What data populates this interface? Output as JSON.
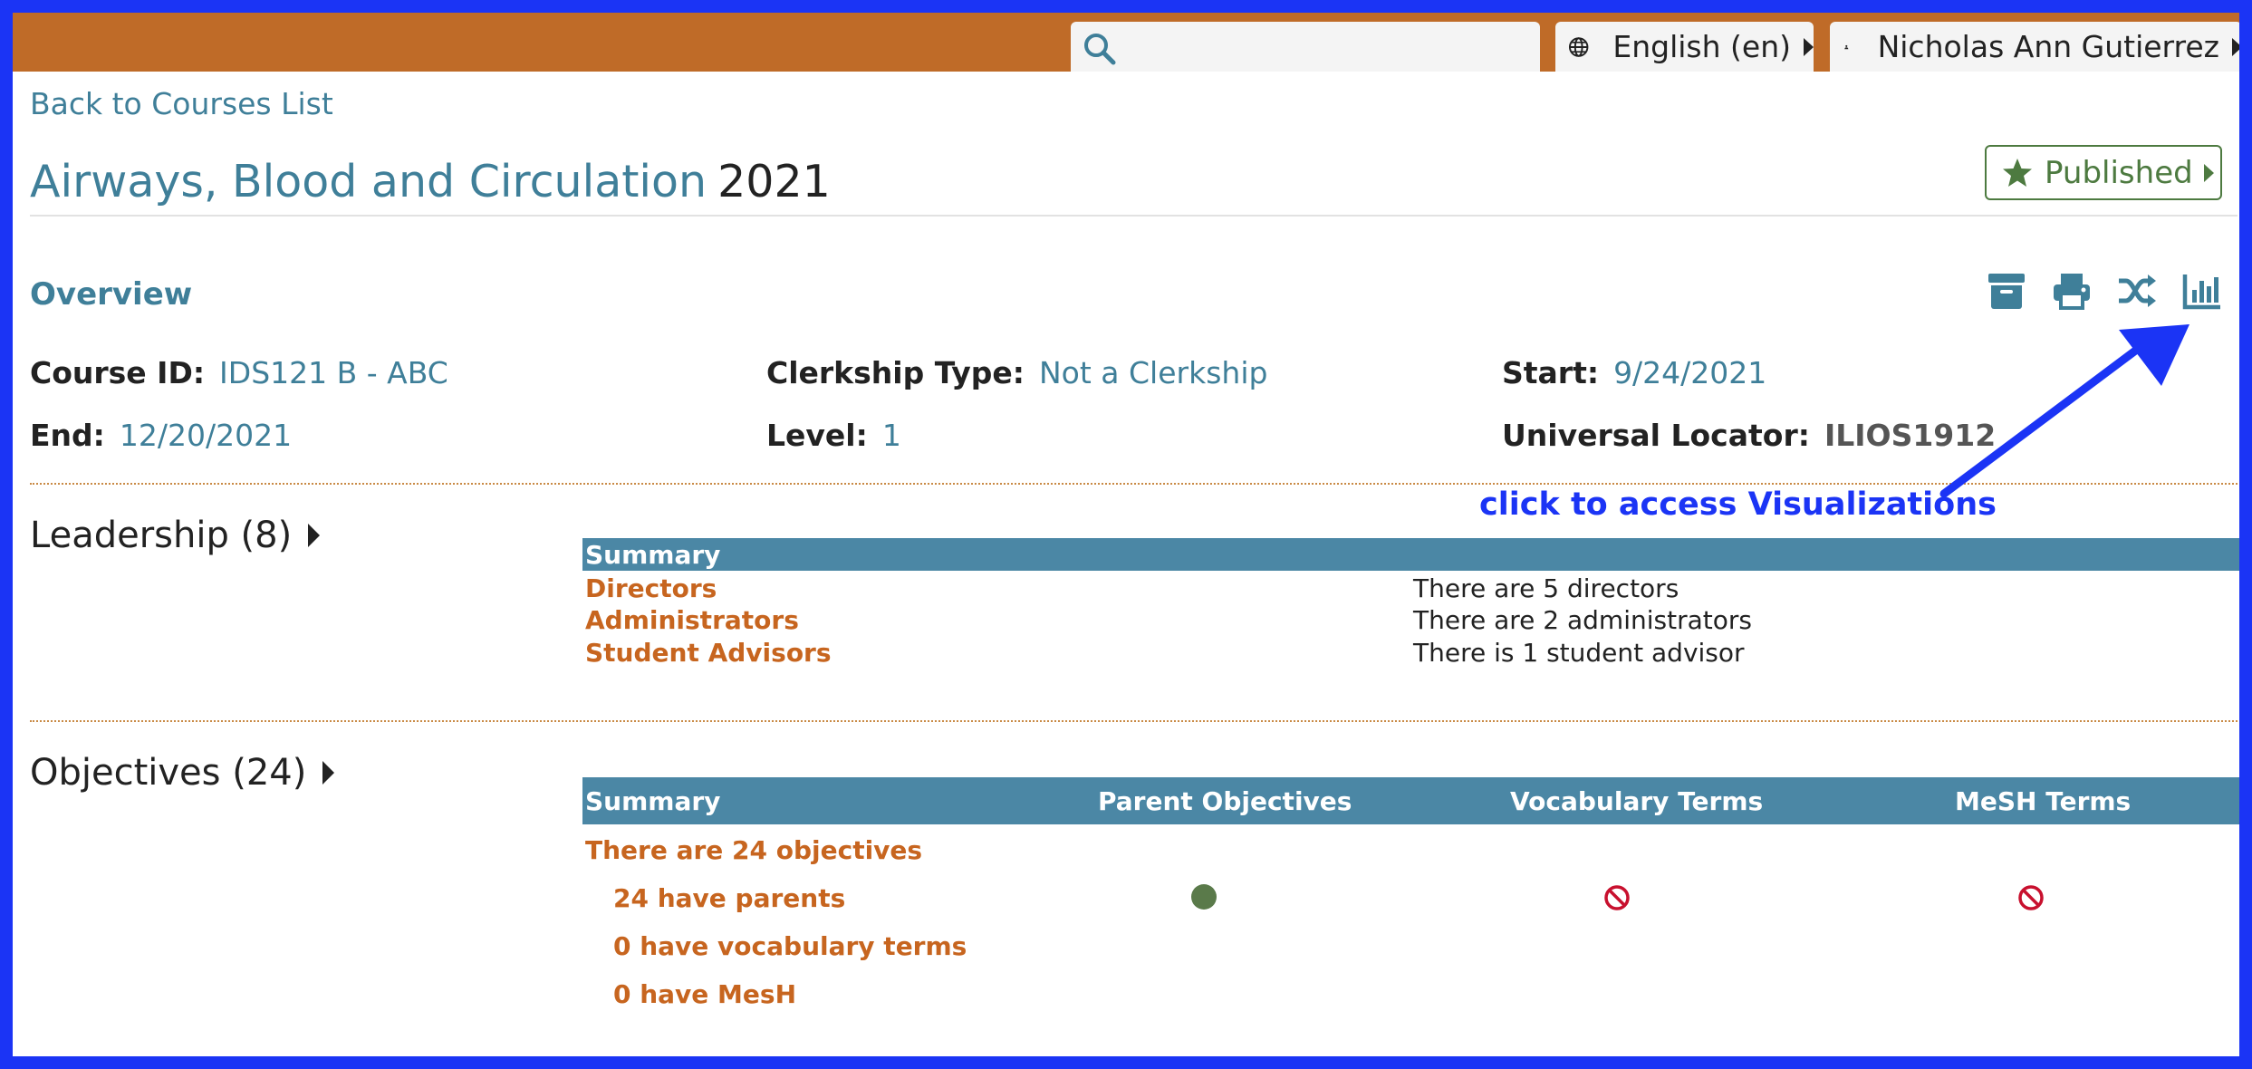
{
  "header": {
    "search_placeholder": "",
    "language": "English (en)",
    "user": "Nicholas Ann Gutierrez"
  },
  "nav": {
    "back_link": "Back to Courses List"
  },
  "course": {
    "title": "Airways, Blood and Circulation",
    "year": "2021",
    "status": "Published"
  },
  "overview": {
    "heading": "Overview",
    "fields": {
      "course_id": {
        "label": "Course ID:",
        "value": "IDS121 B - ABC"
      },
      "clerkship": {
        "label": "Clerkship Type:",
        "value": "Not a Clerkship"
      },
      "start": {
        "label": "Start:",
        "value": "9/24/2021"
      },
      "end": {
        "label": "End:",
        "value": "12/20/2021"
      },
      "level": {
        "label": "Level:",
        "value": "1"
      },
      "locator": {
        "label": "Universal Locator:",
        "value": "ILIOS1912"
      }
    },
    "tools": [
      "archive-icon",
      "print-icon",
      "shuffle-icon",
      "chart-bar-icon"
    ]
  },
  "annotation": {
    "text": "click to access Visualizations",
    "color": "#1b34f5"
  },
  "leadership": {
    "heading": "Leadership (8)",
    "summary_header": "Summary",
    "rows": [
      {
        "label": "Directors",
        "text": "There are 5 directors"
      },
      {
        "label": "Administrators",
        "text": "There are 2 administrators"
      },
      {
        "label": "Student Advisors",
        "text": "There is 1 student advisor"
      }
    ]
  },
  "objectives": {
    "heading": "Objectives (24)",
    "columns": [
      "Summary",
      "Parent Objectives",
      "Vocabulary Terms",
      "MeSH Terms"
    ],
    "summary_line": "There are 24 objectives",
    "rows": [
      {
        "label": "24 have parents",
        "parent": "complete",
        "vocab": "missing",
        "mesh": "missing"
      },
      {
        "label": "0 have vocabulary terms"
      },
      {
        "label": "0 have MesH"
      }
    ]
  },
  "colors": {
    "topbar": "#bf6b28",
    "link": "#3f7f99",
    "table_header": "#4b87a5",
    "accent_orange": "#c7651f",
    "published": "#4d7a40",
    "missing": "#c8102e"
  }
}
